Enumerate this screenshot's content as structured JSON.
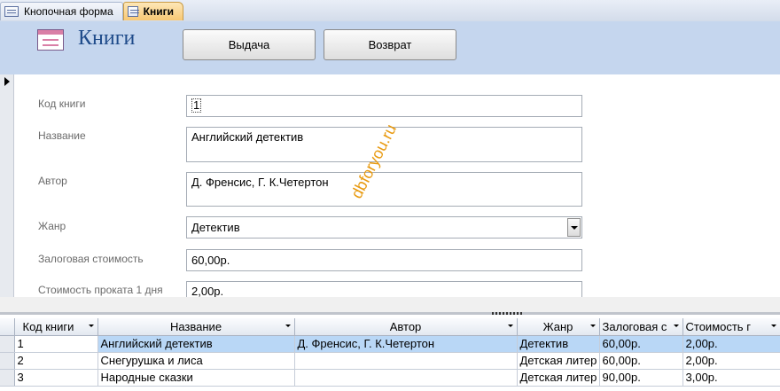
{
  "tabs": [
    {
      "label": "Кнопочная форма"
    },
    {
      "label": "Книги"
    }
  ],
  "header": {
    "title": "Книги",
    "buttons": [
      "Выдача",
      "Возврат"
    ]
  },
  "form": {
    "fields": [
      {
        "label": "Код книги",
        "value": "1"
      },
      {
        "label": "Название",
        "value": "Английский детектив"
      },
      {
        "label": "Автор",
        "value": "Д. Френсис, Г. К.Четертон"
      },
      {
        "label": "Жанр",
        "value": "Детектив"
      },
      {
        "label": "Залоговая стоимость",
        "value": "60,00р."
      },
      {
        "label": "Стоимость проката 1 дня",
        "value": "2,00р."
      }
    ]
  },
  "watermark": "dbforyou.ru",
  "datasheet": {
    "columns": [
      "Код книги",
      "Название",
      "Автор",
      "Жанр",
      "Залоговая с",
      "Стоимость г"
    ],
    "rows": [
      [
        "1",
        "Английский детектив",
        "Д. Френсис, Г. К.Четертон",
        "Детектив",
        "60,00р.",
        "2,00р."
      ],
      [
        "2",
        "Снегурушка и лиса",
        "",
        "Детская литер",
        "60,00р.",
        "2,00р."
      ],
      [
        "3",
        "Народные сказки",
        "",
        "Детская литер",
        "90,00р.",
        "3,00р."
      ]
    ]
  }
}
